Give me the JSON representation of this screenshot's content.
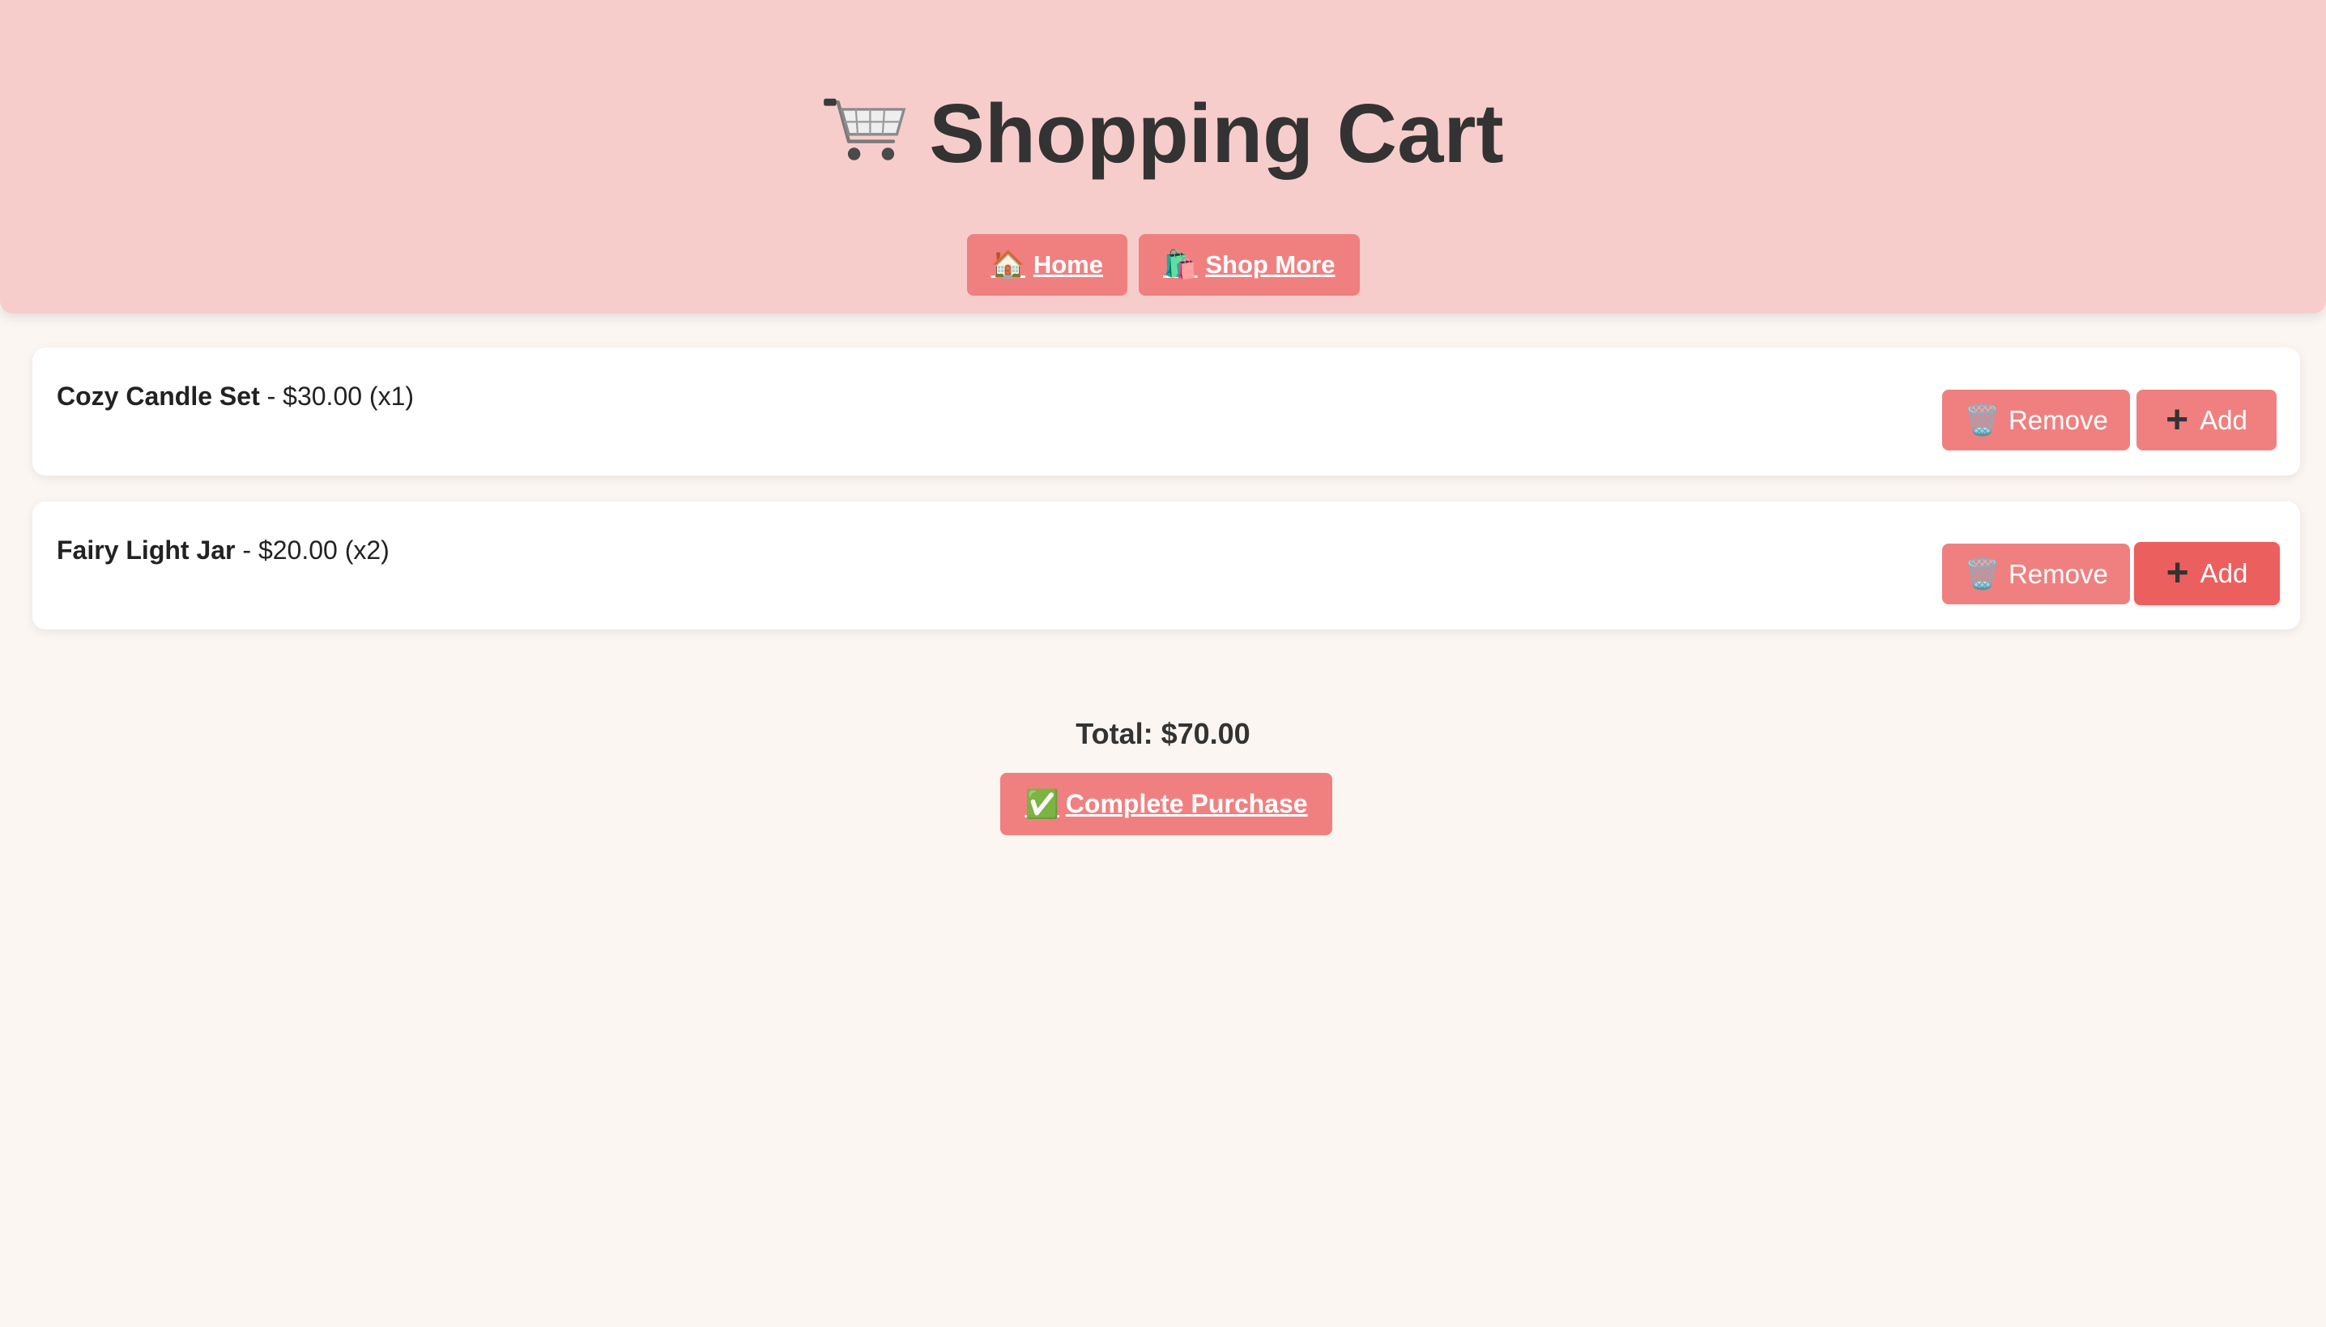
{
  "header": {
    "title": "Shopping Cart",
    "title_icon": "shopping-cart-icon",
    "nav": [
      {
        "emoji": "🏠",
        "label": "Home",
        "icon": "house-icon"
      },
      {
        "emoji": "🛍️",
        "label": "Shop More",
        "icon": "shopping-bags-icon"
      }
    ]
  },
  "cart": {
    "items": [
      {
        "name": "Cozy Candle Set",
        "detail": "- $30.00 (x1)",
        "remove_emoji": "🗑️",
        "remove_label": "Remove",
        "add_symbol": "+",
        "add_label": "Add"
      },
      {
        "name": "Fairy Light Jar",
        "detail": "- $20.00 (x2)",
        "remove_emoji": "🗑️",
        "remove_label": "Remove",
        "add_symbol": "+",
        "add_label": "Add"
      }
    ]
  },
  "summary": {
    "total_label": "Total: $70.00",
    "purchase_emoji": "✅",
    "purchase_label": "Complete Purchase"
  },
  "colors": {
    "header_bg": "#f7cdcb",
    "page_bg": "#fcf6f2",
    "button": "#f08080",
    "button_active": "#ec5f5f"
  }
}
